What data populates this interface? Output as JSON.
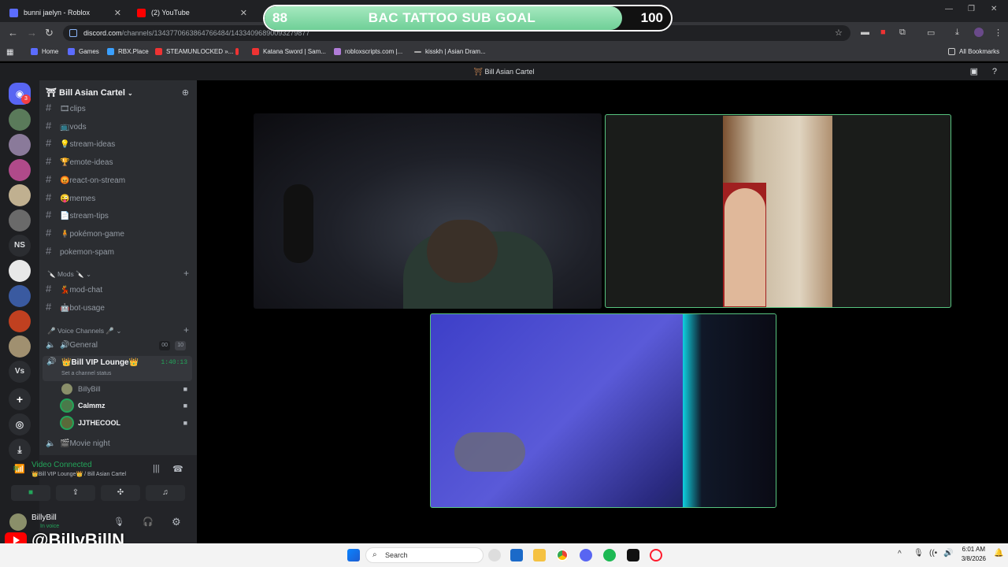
{
  "browser": {
    "tabs": [
      {
        "title": "bunni jaelyn - Roblox"
      },
      {
        "title": "(2) YouTube"
      }
    ],
    "url_host": "discord.com",
    "url_path": "/channels/1343770663864766484/14334096890093279877",
    "bookmarks": [
      {
        "label": "Home",
        "color": "#5b6cff"
      },
      {
        "label": "Games",
        "color": "#5b6cff"
      },
      {
        "label": "RBX.Place",
        "color": "#3aa0ff"
      },
      {
        "label": "STEAMUNLOCKED »...",
        "color": "#e33"
      },
      {
        "label": "",
        "color": "#e33"
      },
      {
        "label": "Katana Sword | Sam...",
        "color": "#e33"
      },
      {
        "label": "robloxscripts.com |...",
        "color": "#b07cd8"
      },
      {
        "label": "kisskh | Asian Dram...",
        "color": "#aaa"
      }
    ],
    "all_bookmarks": "All Bookmarks"
  },
  "overlay": {
    "goal_title": "BAC TATTOO SUB GOAL",
    "current": "88",
    "target": "100",
    "progress": 0.88,
    "watermark": "@BillyBillN"
  },
  "discord": {
    "window_title": "Bill Asian Cartel",
    "server_name": "Bill Asian Cartel",
    "mention_count": "3",
    "text_channels": [
      {
        "name": "clips",
        "emoji": "🎞"
      },
      {
        "name": "vods",
        "emoji": "📺"
      },
      {
        "name": "stream-ideas",
        "emoji": "💡"
      },
      {
        "name": "emote-ideas",
        "emoji": "🏆"
      },
      {
        "name": "react-on-stream",
        "emoji": "😡"
      },
      {
        "name": "memes",
        "emoji": "😜"
      },
      {
        "name": "stream-tips",
        "emoji": "📄"
      },
      {
        "name": "pokémon-game",
        "emoji": "🧍"
      },
      {
        "name": "pokemon-spam",
        "emoji": ""
      }
    ],
    "mods_category": "Mods",
    "mod_channels": [
      {
        "name": "mod-chat",
        "emoji": "💃"
      },
      {
        "name": "bot-usage",
        "emoji": "🤖"
      }
    ],
    "voice_category": "Voice Channels",
    "general": {
      "name": "General",
      "emoji": "🔊",
      "count_a": "00",
      "count_b": "10"
    },
    "vip": {
      "name": "Bill VIP Lounge",
      "emoji": "👑",
      "timer": "1:40:13",
      "status": "Set a channel status"
    },
    "voice_users": [
      {
        "name": "BillyBill",
        "color": "#8a8f6a"
      },
      {
        "name": "Calmmz",
        "color": "#4a7a4a"
      },
      {
        "name": "JJTHECOOL",
        "color": "#5a6a3a"
      }
    ],
    "movie_night": {
      "name": "Movie night",
      "emoji": "🎬"
    },
    "connection": {
      "status": "Video Connected",
      "location": "👑Bill VIP Lounge👑 / Bill Asian Cartel"
    },
    "me": {
      "name": "BillyBill",
      "status": "In voice"
    },
    "servers": [
      {
        "label": "",
        "color": "#5a7a5a"
      },
      {
        "label": "",
        "color": "#8a7a9a"
      },
      {
        "label": "",
        "color": "#b04a8a"
      },
      {
        "label": "",
        "color": "#c0b090"
      },
      {
        "label": "",
        "color": "#6a6a6a"
      },
      {
        "label": "NS",
        "color": "#2b2d31"
      },
      {
        "label": "",
        "color": "#e8e8e8"
      },
      {
        "label": "",
        "color": "#3a5aa0"
      },
      {
        "label": "",
        "color": "#c04020"
      },
      {
        "label": "",
        "color": "#a09070"
      },
      {
        "label": "Vs",
        "color": "#2b2d31"
      }
    ]
  },
  "taskbar": {
    "search": "Search",
    "time": "6:01 AM",
    "date": "3/8/2026"
  }
}
